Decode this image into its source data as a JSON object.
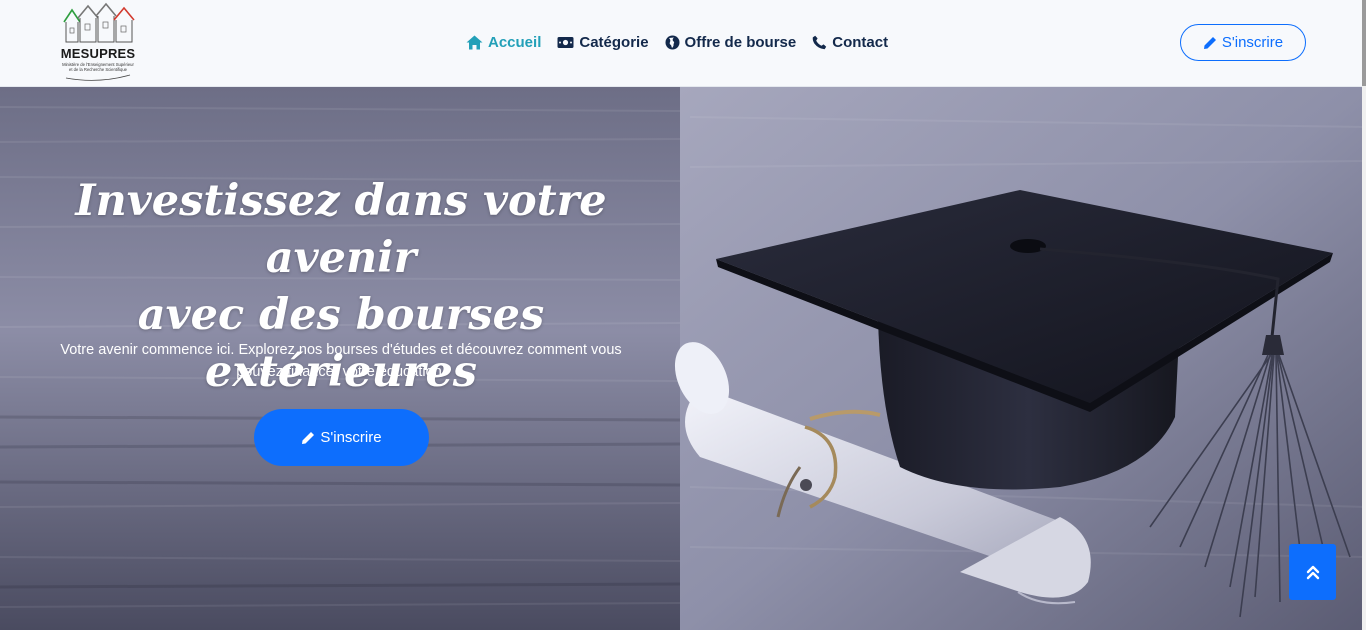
{
  "logo": {
    "title": "MESUPRES",
    "subtitle": "Ministère de l'Enseignement Supérieur et de la Recherche Scientifique"
  },
  "nav": {
    "items": [
      {
        "label": "Accueil",
        "icon": "home-icon",
        "active": true
      },
      {
        "label": "Catégorie",
        "icon": "money-bill-icon",
        "active": false
      },
      {
        "label": "Offre de bourse",
        "icon": "globe-icon",
        "active": false
      },
      {
        "label": "Contact",
        "icon": "phone-icon",
        "active": false
      }
    ],
    "signup_label": "S'inscrire"
  },
  "hero": {
    "title_line1": "Investissez dans votre avenir",
    "title_line2": "avec des bourses extérieures",
    "subtitle": "Votre avenir commence ici. Explorez nos bourses d'études et découvrez comment vous pouvez financer votre éducation.",
    "cta_label": "S'inscrire"
  },
  "back_to_top_icon": "double-chevron-up-icon",
  "colors": {
    "primary": "#0d6efd",
    "nav_text": "#13294b",
    "nav_active": "#23a0b8"
  }
}
